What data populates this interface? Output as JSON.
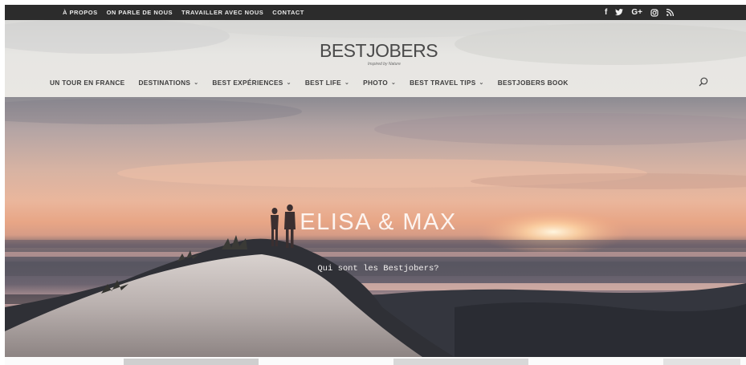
{
  "top_nav": {
    "items": [
      "À PROPOS",
      "ON PARLE DE NOUS",
      "TRAVAILLER AVEC NOUS",
      "CONTACT"
    ]
  },
  "social": {
    "icons": [
      "facebook-icon",
      "twitter-icon",
      "google-plus-icon",
      "instagram-icon",
      "rss-icon"
    ],
    "facebook_glyph": "f",
    "google_glyph": "G+"
  },
  "logo": {
    "text": "BESTJOBERS",
    "tagline": "Inspired by Nature"
  },
  "main_nav": {
    "items": [
      {
        "label": "UN TOUR EN FRANCE",
        "dropdown": false
      },
      {
        "label": "DESTINATIONS",
        "dropdown": true
      },
      {
        "label": "BEST EXPÉRIENCES",
        "dropdown": true
      },
      {
        "label": "BEST LIFE",
        "dropdown": true
      },
      {
        "label": "PHOTO",
        "dropdown": true
      },
      {
        "label": "BEST TRAVEL TIPS",
        "dropdown": true
      },
      {
        "label": "BESTJOBERS BOOK",
        "dropdown": false
      }
    ],
    "caret": "⌄"
  },
  "hero": {
    "title": "ELISA & MAX",
    "link": "Qui sont les Bestjobers?"
  },
  "colors": {
    "topbar": "#2c2c2c",
    "nav_text": "#3e3e3e",
    "sunset": "#e8a686"
  }
}
